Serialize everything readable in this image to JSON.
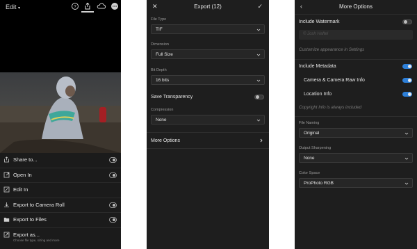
{
  "panel1": {
    "edit_label": "Edit",
    "menu": [
      {
        "label": "Share to...",
        "sub": "",
        "icon": "share-icon",
        "badge": true
      },
      {
        "label": "Open In",
        "sub": "",
        "icon": "open-in-icon",
        "badge": true
      },
      {
        "label": "Edit In",
        "sub": "",
        "icon": "edit-in-icon",
        "badge": false
      },
      {
        "label": "Export to Camera Roll",
        "sub": "",
        "icon": "camera-roll-icon",
        "badge": true
      },
      {
        "label": "Export to Files",
        "sub": "",
        "icon": "folder-icon",
        "badge": true
      },
      {
        "label": "Export as...",
        "sub": "Choose file type, sizing and more",
        "icon": "export-as-icon",
        "badge": false
      }
    ]
  },
  "panel2": {
    "title": "Export (12)",
    "file_type_label": "File Type",
    "file_type_value": "TIF",
    "dimension_label": "Dimension",
    "dimension_value": "Full Size",
    "bit_depth_label": "Bit Depth",
    "bit_depth_value": "16 bits",
    "save_transparency_label": "Save Transparency",
    "compression_label": "Compression",
    "compression_value": "None",
    "more_options_label": "More Options"
  },
  "panel3": {
    "title": "More Options",
    "include_watermark_label": "Include Watermark",
    "watermark_placeholder": "© Josh Haftel",
    "customize_note": "Customize appearance in Settings",
    "include_metadata_label": "Include Metadata",
    "camera_raw_label": "Camera & Camera Raw Info",
    "location_label": "Location Info",
    "copyright_note": "Copyright Info is always included",
    "file_naming_label": "File Naming",
    "file_naming_value": "Original",
    "output_sharpening_label": "Output Sharpening",
    "output_sharpening_value": "None",
    "color_space_label": "Color Space",
    "color_space_value": "ProPhoto RGB"
  },
  "colors": {
    "accent": "#2d7fd8",
    "panel_bg": "#1e1e1e"
  }
}
